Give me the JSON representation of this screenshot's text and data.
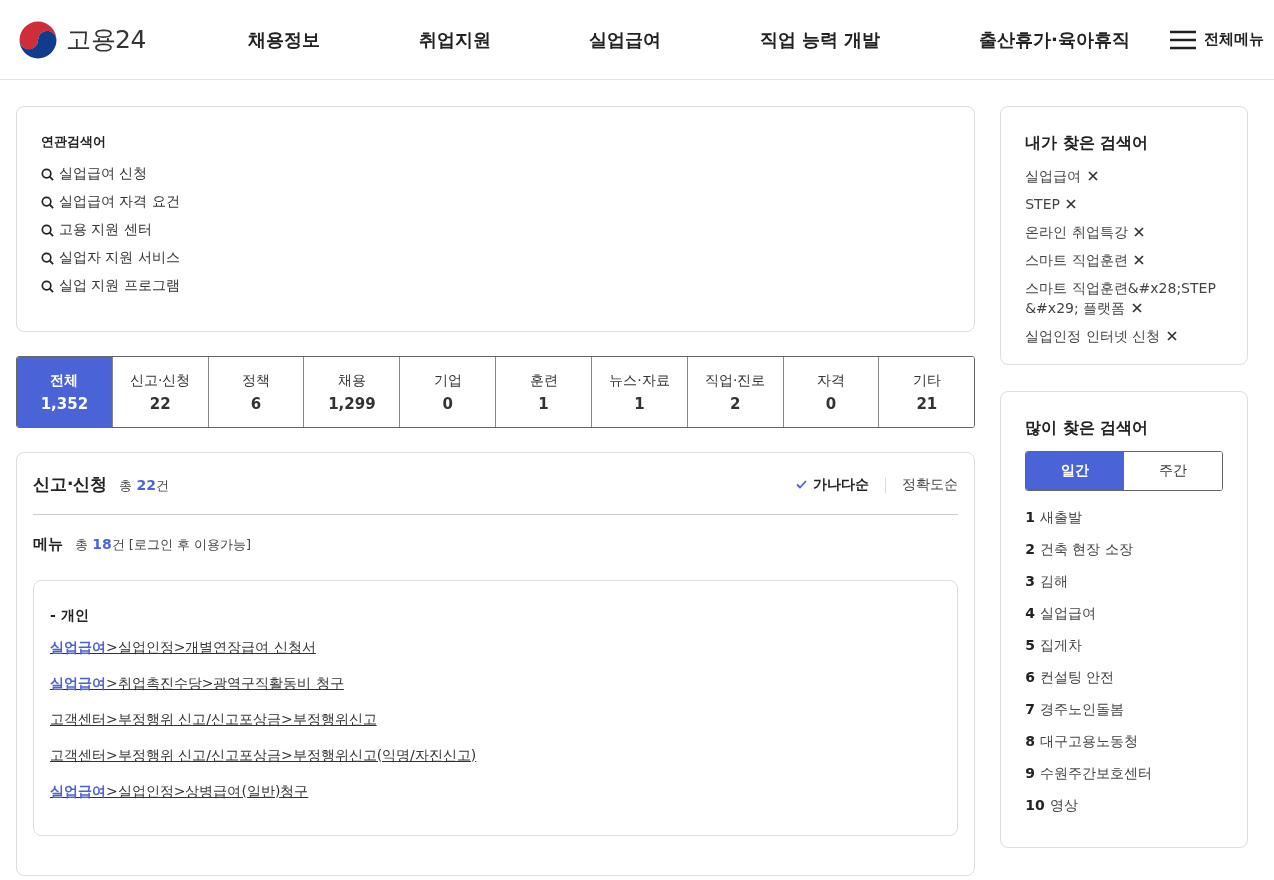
{
  "header": {
    "logo_text": "고용24",
    "nav": [
      "채용정보",
      "취업지원",
      "실업급여",
      "직업 능력 개발",
      "출산휴가·육아휴직"
    ],
    "menu_label": "전체메뉴"
  },
  "related": {
    "title": "연관검색어",
    "items": [
      "실업급여 신청",
      "실업급여 자격 요건",
      "고용 지원 센터",
      "실업자 지원 서비스",
      "실업 지원 프로그램"
    ]
  },
  "tabs": [
    {
      "label": "전체",
      "count": "1,352",
      "selected": true
    },
    {
      "label": "신고·신청",
      "count": "22",
      "selected": false
    },
    {
      "label": "정책",
      "count": "6",
      "selected": false
    },
    {
      "label": "채용",
      "count": "1,299",
      "selected": false
    },
    {
      "label": "기업",
      "count": "0",
      "selected": false
    },
    {
      "label": "훈련",
      "count": "1",
      "selected": false
    },
    {
      "label": "뉴스·자료",
      "count": "1",
      "selected": false
    },
    {
      "label": "직업·진로",
      "count": "2",
      "selected": false
    },
    {
      "label": "자격",
      "count": "0",
      "selected": false
    },
    {
      "label": "기타",
      "count": "21",
      "selected": false
    }
  ],
  "results": {
    "title": "신고·신청",
    "total_prefix": "총",
    "total": "22",
    "total_suffix": "건",
    "sort": [
      {
        "label": "가나다순",
        "selected": true
      },
      {
        "label": "정확도순",
        "selected": false
      }
    ],
    "menu": {
      "title": "메뉴",
      "total_prefix": "총",
      "total": "18",
      "total_suffix": "건 [로그인 후 이용가능]",
      "group": "- 개인",
      "links": [
        {
          "lead": "실업급여",
          "rest": ">실업인정>개별연장급여 신청서",
          "highlighted": true
        },
        {
          "lead": "실업급여",
          "rest": ">취업촉진수당>광역구직활동비 청구",
          "highlighted": true
        },
        {
          "lead": "고객센터",
          "rest": ">부정행위 신고/신고포상금>부정행위신고",
          "highlighted": false
        },
        {
          "lead": "고객센터",
          "rest": ">부정행위 신고/신고포상금>부정행위신고(익명/자진신고)",
          "highlighted": false
        },
        {
          "lead": "실업급여",
          "rest": ">실업인정>상병급여(일반)청구",
          "highlighted": true
        }
      ]
    }
  },
  "my_searches": {
    "title": "내가 찾은 검색어",
    "items": [
      "실업급여",
      "STEP",
      "온라인 취업특강",
      "스마트 직업훈련",
      "스마트 직업훈련&#x28;STEP &#x29; 플랫폼",
      "실업인정 인터넷 신청"
    ]
  },
  "popular": {
    "title": "많이 찾은 검색어",
    "periods": [
      {
        "label": "일간",
        "selected": true
      },
      {
        "label": "주간",
        "selected": false
      }
    ],
    "items": [
      {
        "rank": "1",
        "term": "새출발"
      },
      {
        "rank": "2",
        "term": "건축 현장 소장"
      },
      {
        "rank": "3",
        "term": "김해"
      },
      {
        "rank": "4",
        "term": "실업급여"
      },
      {
        "rank": "5",
        "term": "집게차"
      },
      {
        "rank": "6",
        "term": "컨설팅 안전"
      },
      {
        "rank": "7",
        "term": "경주노인돌봄"
      },
      {
        "rank": "8",
        "term": "대구고용노동청"
      },
      {
        "rank": "9",
        "term": "수원주간보호센터"
      },
      {
        "rank": "10",
        "term": "영상"
      }
    ]
  }
}
